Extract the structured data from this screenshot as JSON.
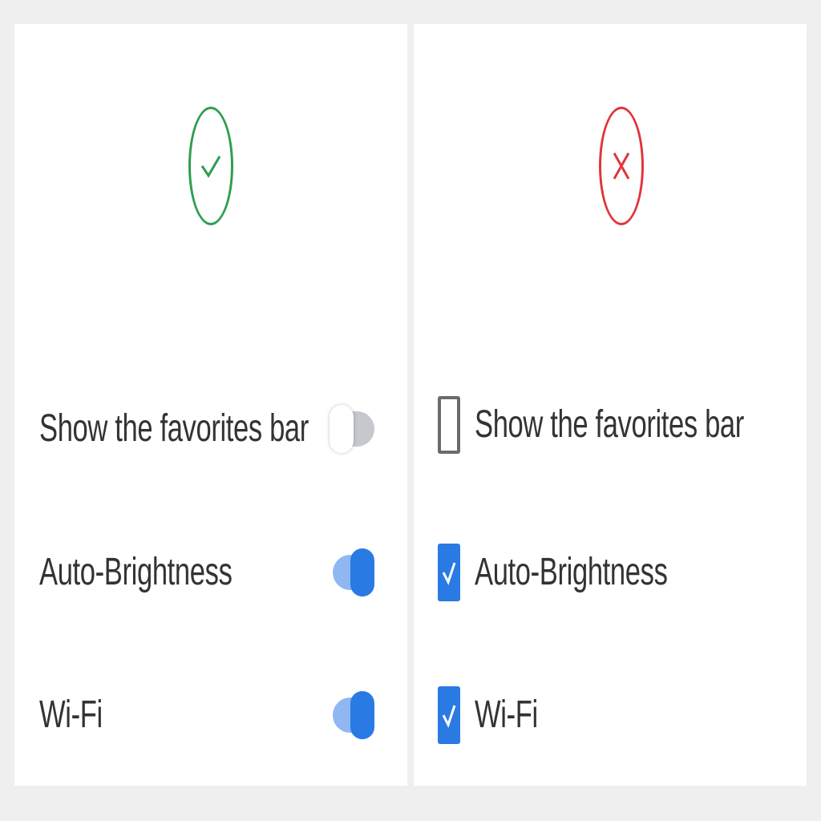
{
  "left_panel": {
    "badge_icon": "check-circle-icon",
    "badge_color": "#2e9e4f",
    "rows": [
      {
        "label": "Show the favorites bar",
        "control": "toggle",
        "state": "off"
      },
      {
        "label": "Auto-Brightness",
        "control": "toggle",
        "state": "on"
      },
      {
        "label": "Wi-Fi",
        "control": "toggle",
        "state": "on"
      }
    ]
  },
  "right_panel": {
    "badge_icon": "x-circle-icon",
    "badge_color": "#e0363b",
    "rows": [
      {
        "label": "Show the favorites bar",
        "control": "checkbox",
        "state": "unchecked"
      },
      {
        "label": "Auto-Brightness",
        "control": "checkbox",
        "state": "checked"
      },
      {
        "label": "Wi-Fi",
        "control": "checkbox",
        "state": "checked"
      }
    ]
  },
  "colors": {
    "accent_blue": "#2a7ae4",
    "toggle_on_track": "#8fb8f3",
    "toggle_off_track": "#c5c8cc"
  }
}
